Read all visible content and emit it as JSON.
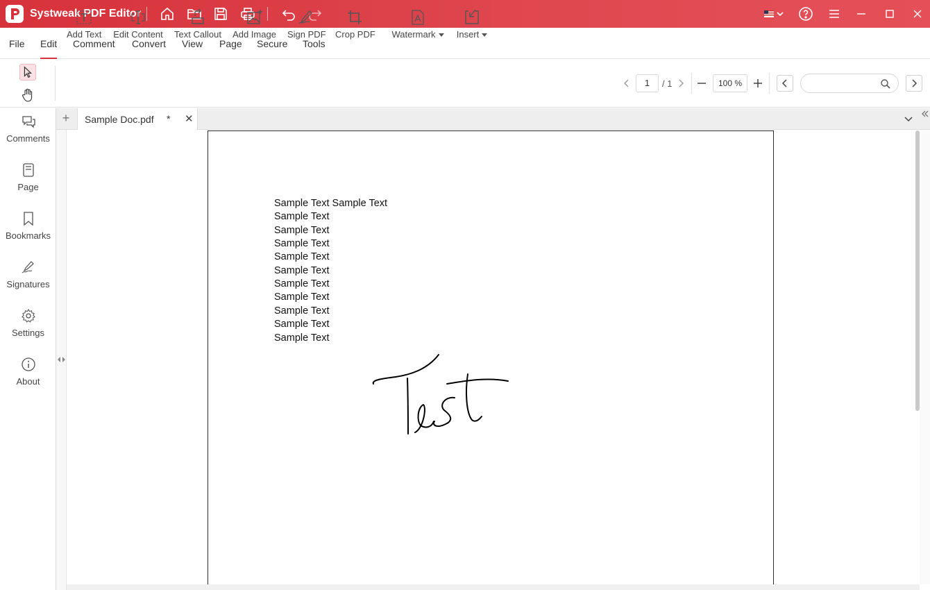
{
  "app": {
    "title": "Systweak PDF Editor",
    "brand_color": "#d6323b"
  },
  "titlebar_icons": [
    "home-icon",
    "folder-open-icon",
    "save-icon",
    "print-icon",
    "undo-icon",
    "redo-icon",
    "us-flag-icon",
    "help-icon",
    "hamburger-menu-icon",
    "minimize-icon",
    "maximize-icon",
    "close-icon"
  ],
  "menu": {
    "items": [
      "File",
      "Edit",
      "Comment",
      "Convert",
      "View",
      "Page",
      "Secure",
      "Tools"
    ],
    "active": "Edit"
  },
  "toolbar": {
    "tools": [
      {
        "label": "Add Text",
        "icon": "add-text-icon"
      },
      {
        "label": "Edit Content",
        "icon": "edit-content-icon"
      },
      {
        "label": "Text Callout",
        "icon": "text-callout-icon"
      },
      {
        "label": "Add Image",
        "icon": "add-image-icon"
      },
      {
        "label": "Sign PDF",
        "icon": "sign-pdf-icon"
      },
      {
        "label": "Crop PDF",
        "icon": "crop-icon"
      },
      {
        "label": "Watermark",
        "icon": "watermark-icon"
      },
      {
        "label": "Insert",
        "icon": "insert-icon"
      }
    ],
    "page_current": "1",
    "page_total": "/ 1",
    "zoom": "100 %",
    "search_placeholder": ""
  },
  "sidebar": {
    "items": [
      {
        "label": "Comments",
        "icon": "comments-icon"
      },
      {
        "label": "Page",
        "icon": "page-icon"
      },
      {
        "label": "Bookmarks",
        "icon": "bookmark-icon"
      },
      {
        "label": "Signatures",
        "icon": "signature-icon"
      },
      {
        "label": "Settings",
        "icon": "gear-icon"
      },
      {
        "label": "About",
        "icon": "info-icon"
      }
    ]
  },
  "tabs": {
    "add_label": "+",
    "items": [
      {
        "title": "Sample Doc.pdf",
        "dirty_marker": "*",
        "close": "✕"
      }
    ]
  },
  "document": {
    "lines": [
      "Sample Text Sample Text",
      "Sample Text",
      "Sample Text",
      "Sample Text",
      "Sample Text",
      "Sample Text",
      "Sample Text",
      "Sample Text",
      "Sample Text",
      "Sample Text",
      "Sample Text"
    ],
    "signature_text": "Test"
  }
}
